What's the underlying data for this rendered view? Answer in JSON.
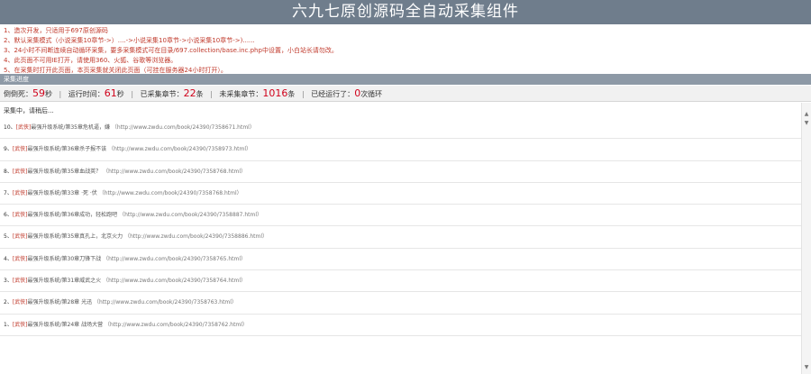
{
  "header": {
    "title": "六九七原创源码全自动采集组件"
  },
  "notices": [
    "1、造次开发，只适用于697原创源码",
    "2、默认采集模式（小说采集10章节->）....->小说采集10章节->小说采集10章节->)......",
    "3、24小时不间断连续自动循环采集，要多采集模式可在目录/697.collection/base.inc.php中设置，小白站长请勿改。",
    "4、此页面不可用IE打开，请使用360、火狐、谷歌等浏览器。",
    "5、在采集时打开此页面，本页采集就关闭此页面（可挂在服务器24小时打开）。"
  ],
  "section": {
    "label": "采集进度"
  },
  "stats": {
    "countdown_label": "倒倒死：",
    "countdown_value": "59",
    "countdown_unit": "秒",
    "runtime_label": "运行时间：",
    "runtime_value": "61",
    "runtime_unit": "秒",
    "collected_label": "已采集章节：",
    "collected_value": "22",
    "collected_unit": "条",
    "uncollected_label": "未采集章节：",
    "uncollected_value": "1016",
    "uncollected_unit": "条",
    "cycles_label": "已经运行了：",
    "cycles_value": "0",
    "cycles_unit": "次循环"
  },
  "log": {
    "status": "采集中，请稍后...",
    "rows": [
      {
        "index": "10、",
        "category": "[武侠]",
        "title": "最强升级系统/第35章危机逼，嫌",
        "url": "（http://www.zwdu.com/book/24390/7358671.html）"
      },
      {
        "index": "9、",
        "category": "[武侠]",
        "title": "最强升级系统/第36章杀子报不该",
        "url": "（http://www.zwdu.com/book/24390/7358973.html）"
      },
      {
        "index": "8、",
        "category": "[武侠]",
        "title": "最强升级系统/第35章血战英？",
        "url": "（http://www.zwdu.com/book/24390/7358768.html）"
      },
      {
        "index": "7、",
        "category": "[武侠]",
        "title": "最强升级系统/第33章 ·死 ·伏",
        "url": "（http://www.zwdu.com/book/24390/7358768.html）"
      },
      {
        "index": "6、",
        "category": "[武侠]",
        "title": "最强升级系统/第36章成功，轻松跑吧",
        "url": "（http://www.zwdu.com/book/24390/7358887.html）"
      },
      {
        "index": "5、",
        "category": "[武侠]",
        "title": "最强升级系统/第35章真孔上，北京火力",
        "url": "（http://www.zwdu.com/book/24390/7358886.html）"
      },
      {
        "index": "4、",
        "category": "[武侠]",
        "title": "最强升级系统/第30章刀锋下战",
        "url": "（http://www.zwdu.com/book/24390/7358765.html）"
      },
      {
        "index": "3、",
        "category": "[武侠]",
        "title": "最强升级系统/第31章威武之火",
        "url": "（http://www.zwdu.com/book/24390/7358764.html）"
      },
      {
        "index": "2、",
        "category": "[武侠]",
        "title": "最强升级系统/第28章 光迅",
        "url": "（http://www.zwdu.com/book/24390/7358763.html）"
      },
      {
        "index": "1、",
        "category": "[武侠]",
        "title": "最强升级系统/第24章 战场大营",
        "url": "（http://www.zwdu.com/book/24390/7358762.html）"
      }
    ]
  },
  "colors": {
    "title_bar": "#6f7d8c",
    "section_bar": "#8d99a6",
    "accent_red": "#d0021b"
  },
  "icons": {
    "scroll_up": "scroll-up-arrow-icon",
    "scroll_down": "scroll-down-arrow-icon"
  }
}
